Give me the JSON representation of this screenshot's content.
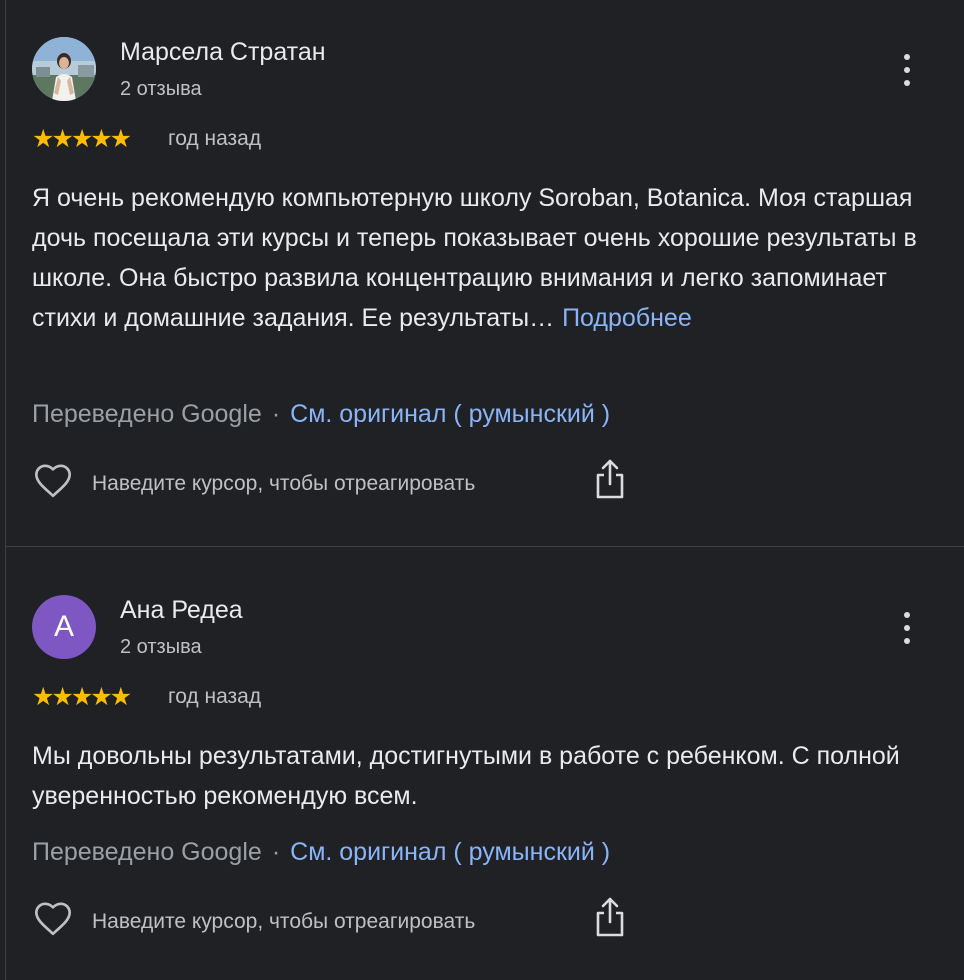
{
  "reviews": [
    {
      "author": "Марсела Стратан",
      "review_count": "2 отзыва",
      "avatar": "profile-photo",
      "stars": "★★★★★",
      "rating": 5,
      "age": "год назад",
      "text": "Я очень рекомендую компьютерную школу Soroban, Botanica. Моя старшая дочь посещала эти курсы и теперь показывает очень хорошие результаты в школе. Она быстро развила концентрацию внимания и легко запоминает стихи и домашние задания. Ее результаты…",
      "more_label": "Подробнее",
      "translated_label": "Переведено Google",
      "separator": "·",
      "original_label": "См. оригинал ( румынский )",
      "react_hint": "Наведите курсор, чтобы отреагировать"
    },
    {
      "author": "Ана Редеа",
      "review_count": "2 отзыва",
      "avatar_letter": "A",
      "stars": "★★★★★",
      "rating": 5,
      "age": "год назад",
      "text": "Мы довольны результатами, достигнутыми в работе с ребенком. С полной уверенностью рекомендую всем.",
      "translated_label": "Переведено Google",
      "separator": "·",
      "original_label": "См. оригинал ( румынский )",
      "react_hint": "Наведите курсор, чтобы отреагировать"
    }
  ],
  "icons": {
    "menu": "more-vert-icon",
    "like": "heart-outline-icon",
    "share": "share-icon"
  },
  "colors": {
    "background": "#202124",
    "text": "#e8eaed",
    "secondary_text": "#bdc1c6",
    "muted_text": "#9aa0a6",
    "link": "#8ab4f8",
    "stars": "#fbbc04",
    "avatar_letter_bg": "#7e57c2",
    "divider": "#3c4043"
  }
}
